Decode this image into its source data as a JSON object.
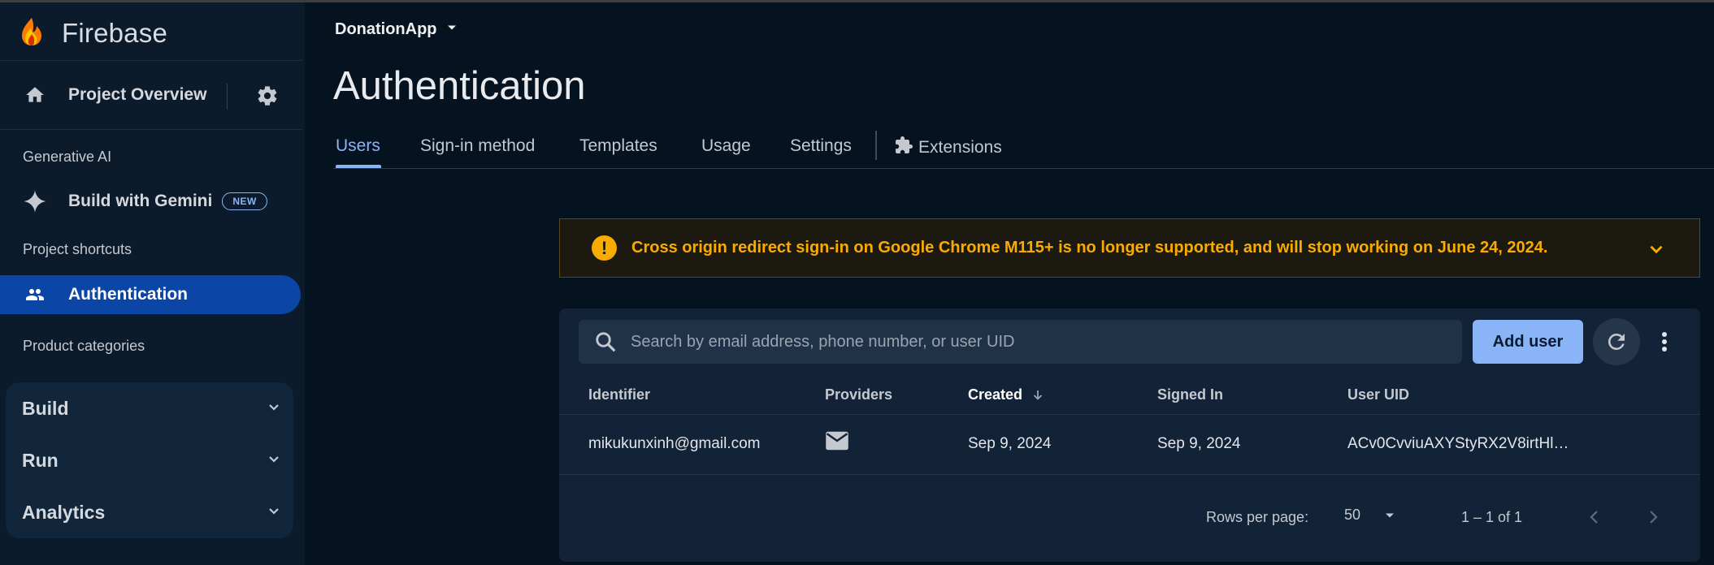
{
  "sidebar": {
    "brand": "Firebase",
    "project_overview": "Project Overview",
    "sections": {
      "generative_ai": "Generative AI",
      "project_shortcuts": "Project shortcuts",
      "product_categories": "Product categories"
    },
    "gemini": {
      "label": "Build with Gemini",
      "badge": "NEW"
    },
    "active_item": "Authentication",
    "categories": [
      "Build",
      "Run",
      "Analytics"
    ]
  },
  "header": {
    "project_name": "DonationApp",
    "page_title": "Authentication",
    "tabs": [
      "Users",
      "Sign-in method",
      "Templates",
      "Usage",
      "Settings",
      "Extensions"
    ],
    "active_tab": "Users"
  },
  "banner": {
    "text": "Cross origin redirect sign-in on Google Chrome M115+ is no longer supported, and will stop working on June 24, 2024.",
    "color": "#f9ab00"
  },
  "users": {
    "search_placeholder": "Search by email address, phone number, or user UID",
    "add_user": "Add user",
    "columns": [
      "Identifier",
      "Providers",
      "Created",
      "Signed In",
      "User UID"
    ],
    "sorted_column": "Created",
    "rows": [
      {
        "identifier": "mikukunxinh@gmail.com",
        "provider_icon": "email-icon",
        "created": "Sep 9, 2024",
        "signed_in": "Sep 9, 2024",
        "uid": "ACv0CvviuAXYStyRX2V8irtHl…"
      }
    ],
    "pagination": {
      "rows_per_page_label": "Rows per page:",
      "rows_per_page": "50",
      "range": "1 – 1 of 1"
    }
  },
  "colors": {
    "accent": "#8ab4f8",
    "active_nav": "#0b45a5",
    "warning": "#f9ab00",
    "background": "#051220"
  }
}
